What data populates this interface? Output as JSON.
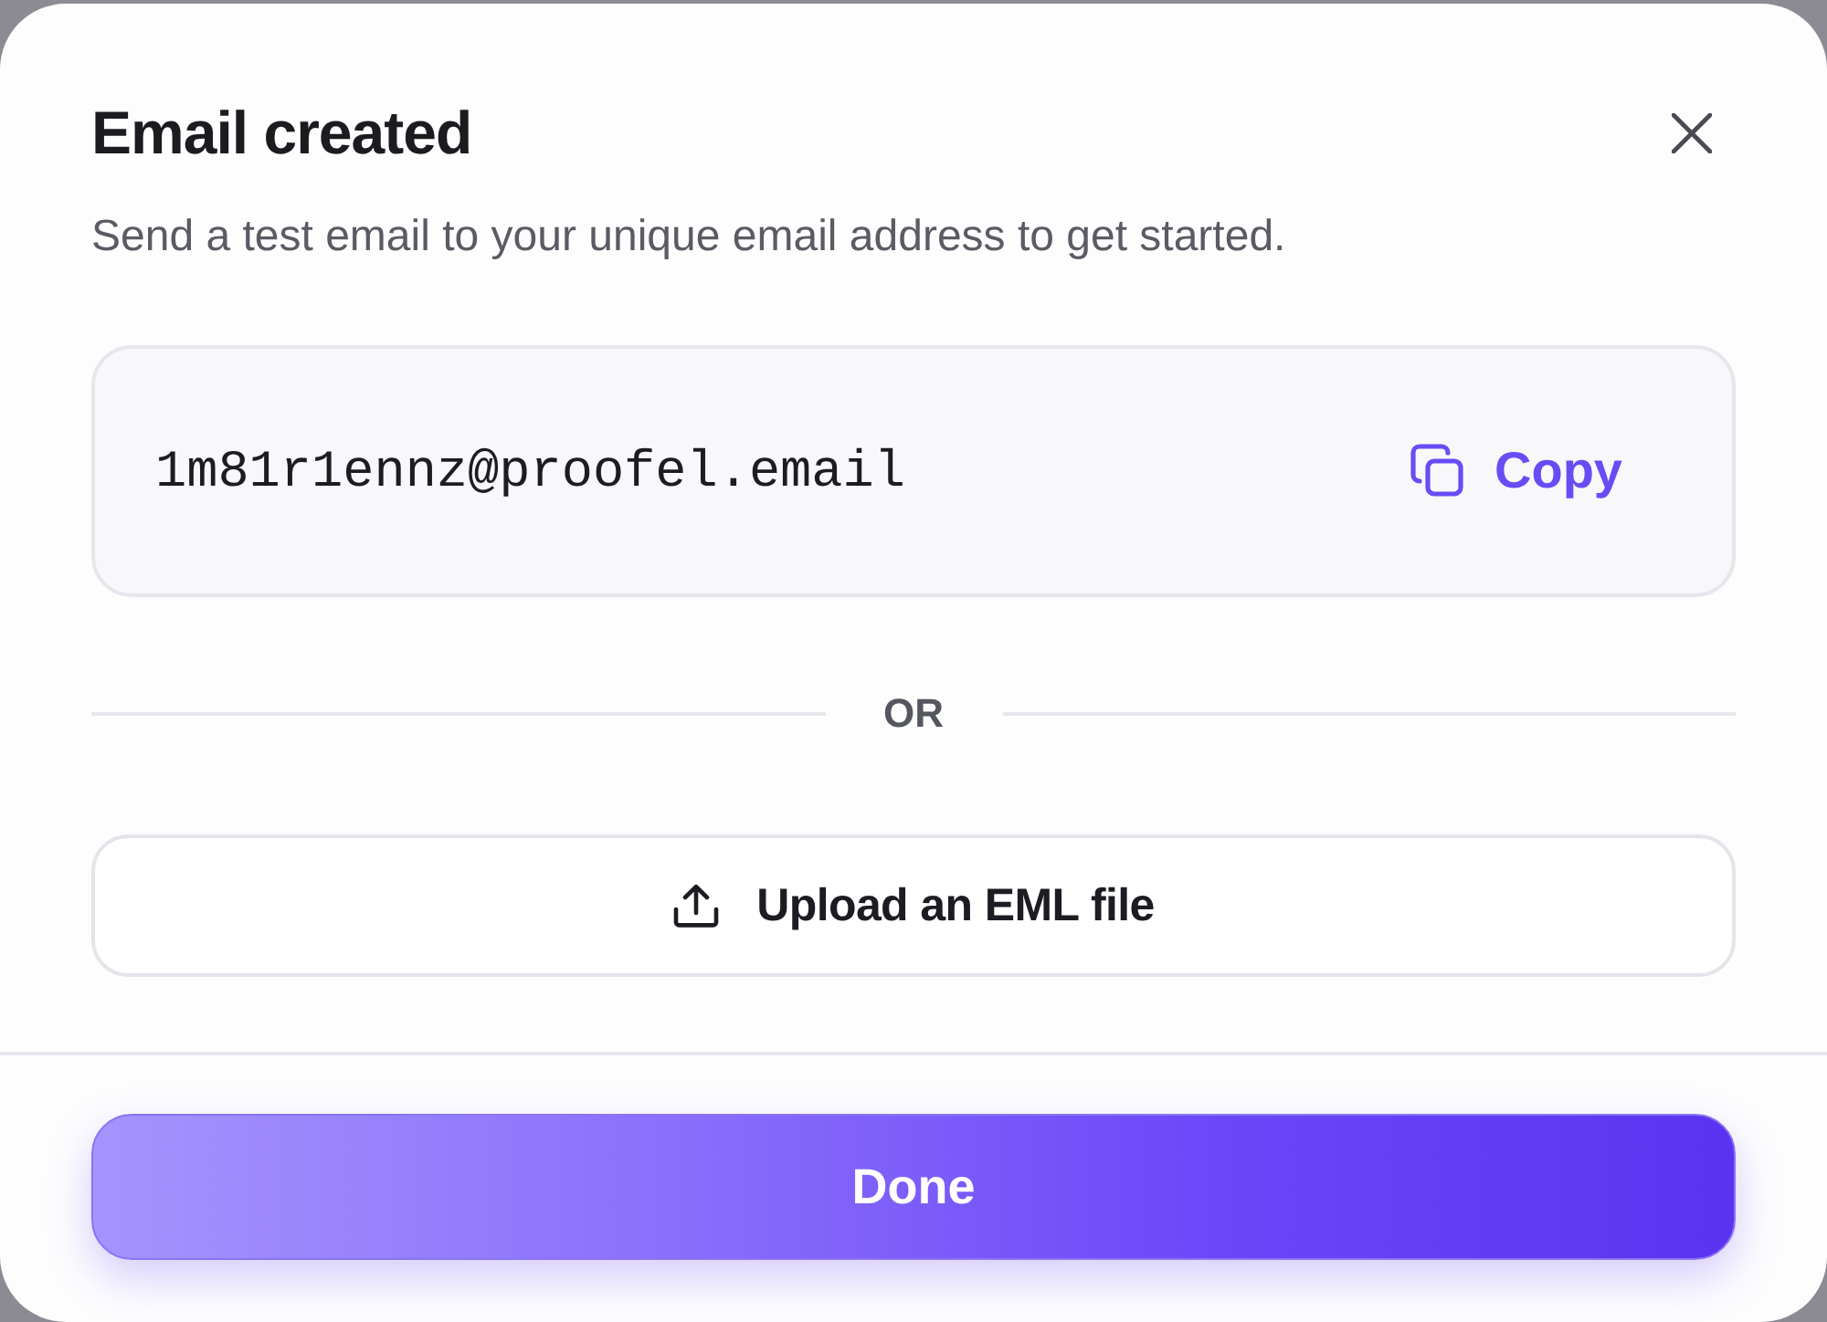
{
  "dialog": {
    "title": "Email created",
    "subtitle": "Send a test email to your unique email address to get started."
  },
  "address_box": {
    "address": "1m81r1ennz@proofel.email",
    "copy_button": "Copy"
  },
  "divider": {
    "label": "OR"
  },
  "upload_button": "Upload an EML file",
  "footer": {
    "done_button": "Done"
  }
}
